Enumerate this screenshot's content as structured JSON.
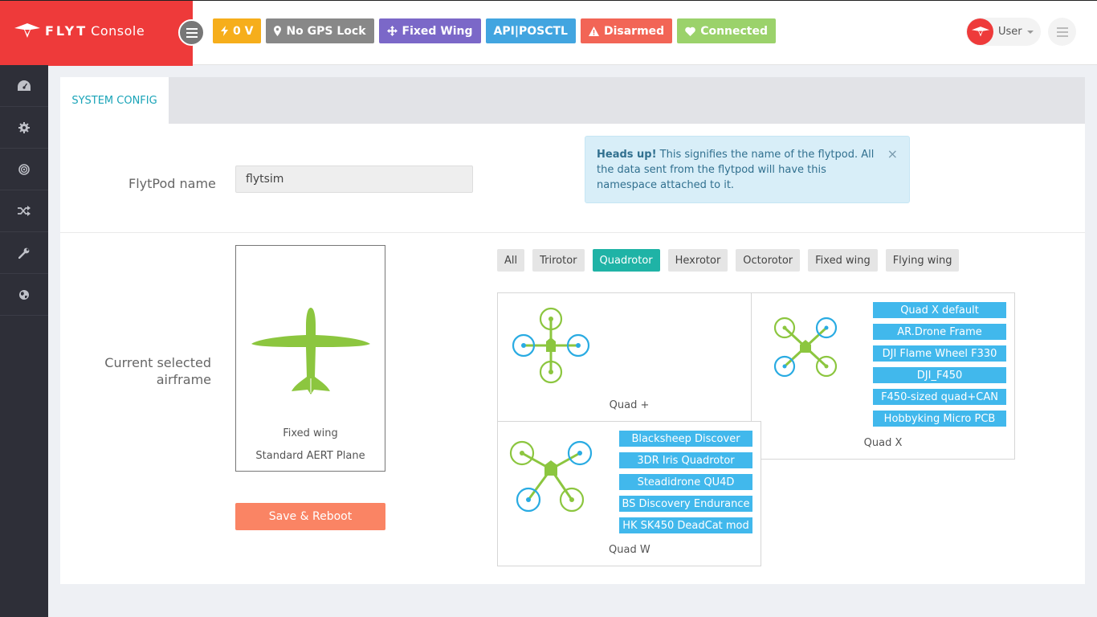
{
  "brand": {
    "name_bold": "FLYT",
    "name_rest": "Console"
  },
  "status_badges": [
    {
      "label": "0 V",
      "icon": "bolt-icon",
      "color": "#f6ae1b"
    },
    {
      "label": "No GPS Lock",
      "icon": "map-marker-icon",
      "color": "#888888"
    },
    {
      "label": "Fixed Wing",
      "icon": "move-arrows-icon",
      "color": "#7b68c8"
    },
    {
      "label": "API|POSCTL",
      "icon": "",
      "color": "#42a5e0"
    },
    {
      "label": "Disarmed",
      "icon": "warning-icon",
      "color": "#f26556"
    },
    {
      "label": "Connected",
      "icon": "heart-icon",
      "color": "#9bd26b"
    }
  ],
  "user": {
    "name": "User"
  },
  "sidebar": {
    "items": [
      {
        "name": "dashboard",
        "icon": "dashboard-gauge-icon"
      },
      {
        "name": "settings",
        "icon": "gear-icon"
      },
      {
        "name": "target",
        "icon": "target-icon"
      },
      {
        "name": "shuffle",
        "icon": "shuffle-icon"
      },
      {
        "name": "tools",
        "icon": "wrench-icon"
      },
      {
        "name": "globe",
        "icon": "globe-icon"
      }
    ]
  },
  "tabs": {
    "active_label": "SYSTEM CONFIG"
  },
  "flytpod": {
    "label": "FlytPod name",
    "value": "flytsim",
    "alert_bold": "Heads up!",
    "alert_text": " This signifies the name of the flytpod. All the data sent from the flytpod will have this namespace attached to it.",
    "alert_close": "×"
  },
  "airframe": {
    "label_line1": "Current selected",
    "label_line2": "airframe",
    "selected_type": "Fixed wing",
    "selected_name": "Standard AERT Plane",
    "save_label": "Save & Reboot"
  },
  "filters": [
    "All",
    "Trirotor",
    "Quadrotor",
    "Hexrotor",
    "Octorotor",
    "Fixed wing",
    "Flying wing"
  ],
  "active_filter": "Quadrotor",
  "frames": {
    "quad_plus": {
      "title": "Quad +",
      "variants": []
    },
    "quad_x": {
      "title": "Quad X",
      "variants": [
        "Quad X default",
        "AR.Drone Frame",
        "DJI Flame Wheel F330",
        "DJI_F450",
        "F450-sized quad+CAN",
        "Hobbyking Micro PCB"
      ]
    },
    "quad_w": {
      "title": "Quad W",
      "variants": [
        "Blacksheep Discover",
        "3DR Iris Quadrotor",
        "Steadidrone QU4D",
        "BS Discovery Endurance",
        "HK SK450 DeadCat mod"
      ]
    }
  },
  "colors": {
    "accent_red": "#ee3a3a",
    "teal": "#1fb3a6",
    "rotor_green": "#8cc63f",
    "rotor_blue": "#29abe2",
    "variant_blue": "#41b8ec",
    "save": "#fa8464"
  }
}
